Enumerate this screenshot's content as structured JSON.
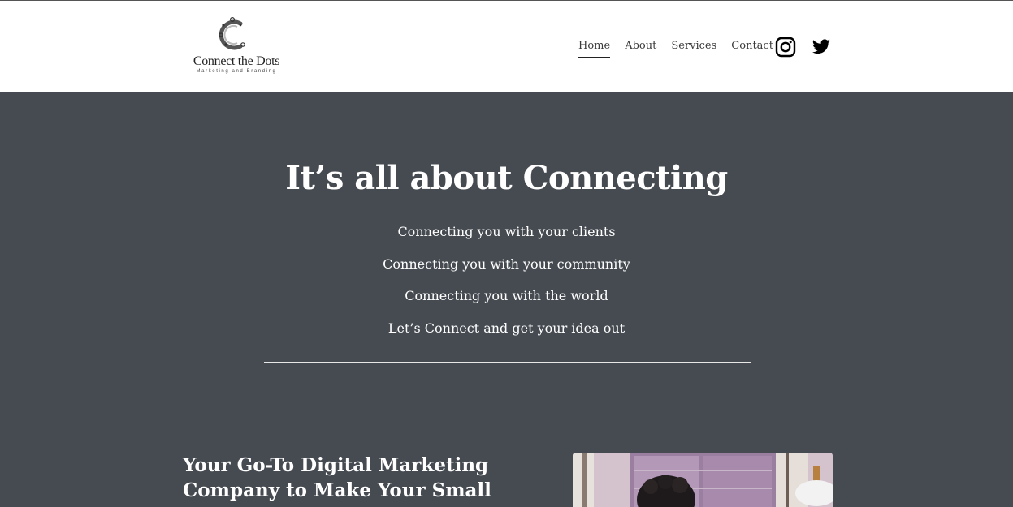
{
  "header": {
    "logo": {
      "name": "Connect the Dots",
      "tagline": "Marketing and Branding"
    },
    "nav": [
      {
        "label": "Home",
        "active": true
      },
      {
        "label": "About",
        "active": false
      },
      {
        "label": "Services",
        "active": false
      },
      {
        "label": "Contact",
        "active": false
      }
    ],
    "social": [
      {
        "icon": "instagram-icon"
      },
      {
        "icon": "twitter-icon"
      }
    ]
  },
  "hero": {
    "title": "It’s all about Connecting",
    "lines": [
      "Connecting you with your clients",
      "Connecting you with your community",
      "Connecting you with the world",
      "Let’s Connect and get your idea out"
    ]
  },
  "intro": {
    "heading": "Your Go-To Digital Marketing Company to Make Your Small Business Talk of the"
  },
  "colors": {
    "hero_background": "#464b52",
    "header_background": "#ffffff",
    "text_light": "#ffffff",
    "nav_text": "#3a3a3a"
  }
}
